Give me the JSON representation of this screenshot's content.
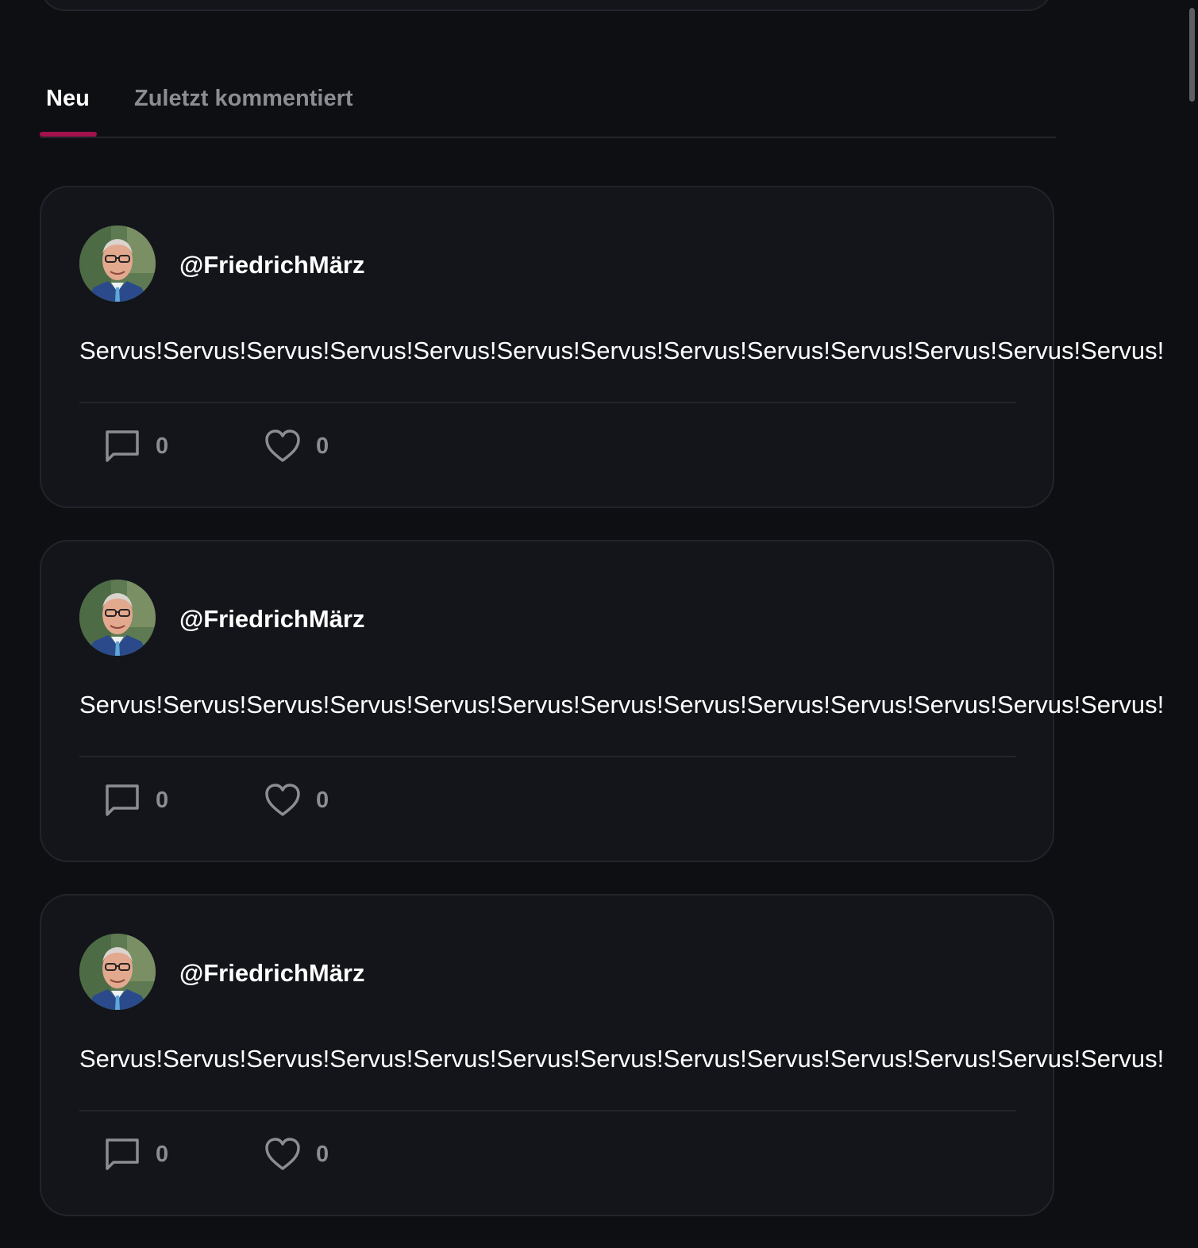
{
  "tabs": {
    "new_label": "Neu",
    "recent_label": "Zuletzt kommentiert"
  },
  "posts": [
    {
      "username": "@FriedrichMärz",
      "text": "Servus!Servus!Servus!Servus!Servus!Servus!Servus!Servus!Servus!Servus!Servus!Servus!Servus!",
      "comments": "0",
      "likes": "0"
    },
    {
      "username": "@FriedrichMärz",
      "text": "Servus!Servus!Servus!Servus!Servus!Servus!Servus!Servus!Servus!Servus!Servus!Servus!Servus!",
      "comments": "0",
      "likes": "0"
    },
    {
      "username": "@FriedrichMärz",
      "text": "Servus!Servus!Servus!Servus!Servus!Servus!Servus!Servus!Servus!Servus!Servus!Servus!Servus!",
      "comments": "0",
      "likes": "0"
    }
  ],
  "colors": {
    "background": "#0e0f13",
    "card": "#13151a",
    "accent": "#a3114d",
    "muted": "#8c8d92"
  },
  "icons": {
    "comment": "comment-icon",
    "like": "heart-icon"
  }
}
